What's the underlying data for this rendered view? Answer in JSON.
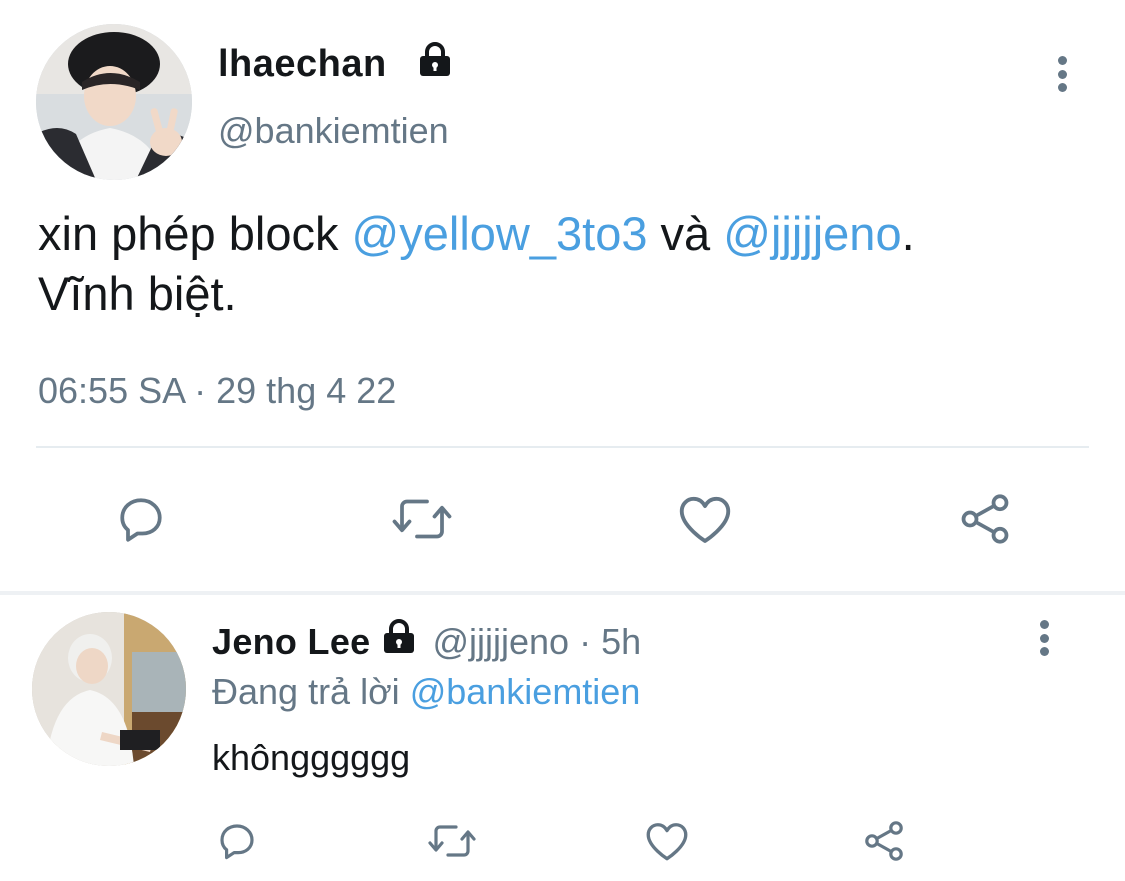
{
  "tweet": {
    "author_name": "lhaechan",
    "author_handle": "@bankiemtien",
    "protected_icon": "lock-icon",
    "text_before": "xin phép block ",
    "mention_1": "@yellow_3to3",
    "text_middle": " và ",
    "mention_2": "@jjjjjeno",
    "text_after": ".",
    "text_line_2": "Vĩnh biệt.",
    "timestamp": "06:55 SA · 29 thg 4 22",
    "actions": [
      "reply-icon",
      "retweet-icon",
      "like-icon",
      "share-icon"
    ]
  },
  "reply": {
    "author_name": "Jeno Lee",
    "author_handle": "@jjjjjeno",
    "separator": " · ",
    "age": "5h",
    "replying_label": "Đang trả lời ",
    "replying_to": "@bankiemtien",
    "text": "khôngggggg",
    "actions": [
      "reply-icon",
      "retweet-icon",
      "like-icon",
      "share-icon"
    ]
  },
  "colors": {
    "accent": "#4a9fe0",
    "secondary_text": "#657786",
    "icon": "#657786"
  }
}
